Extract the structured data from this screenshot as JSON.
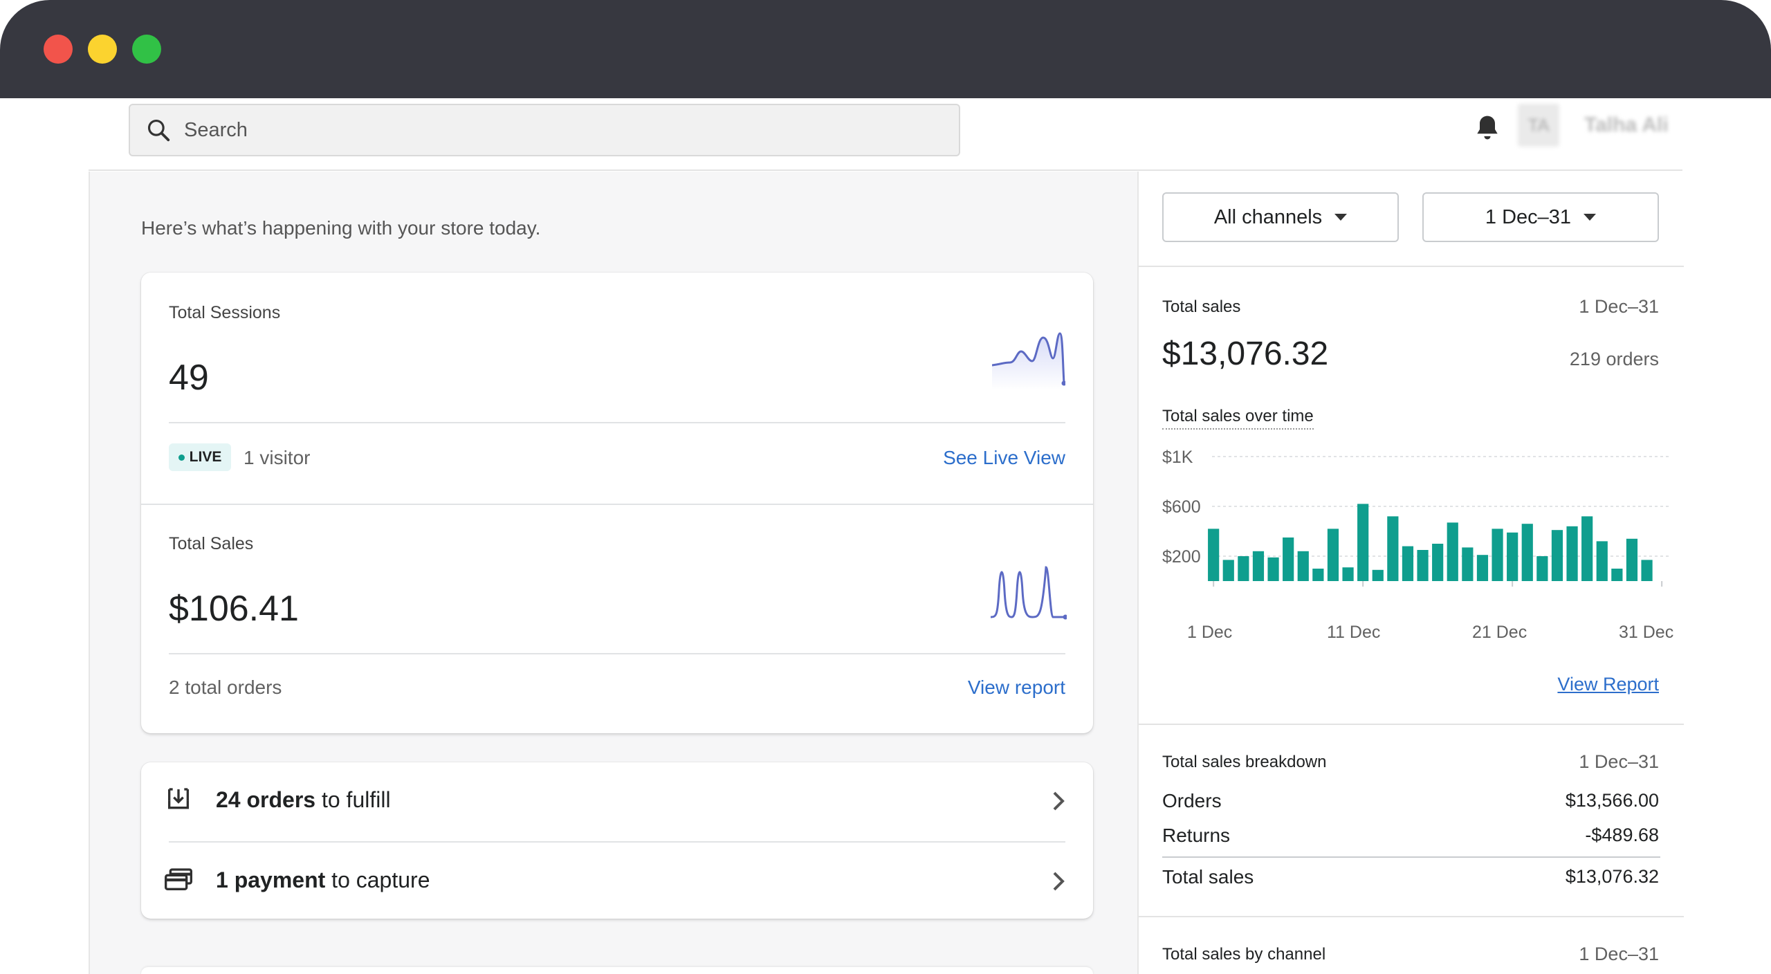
{
  "window": {
    "controls": [
      "close",
      "minimize",
      "maximize"
    ]
  },
  "topbar": {
    "search_placeholder": "Search",
    "search_icon": "search-icon",
    "notification_icon": "bell-icon",
    "avatar_initials": "TA",
    "user_name": "Talha Ali"
  },
  "home": {
    "subtitle": "Here’s what’s happening with your store today.",
    "sessions": {
      "label": "Total Sessions",
      "value": "49",
      "live_badge": "LIVE",
      "visitors": "1 visitor",
      "link": "See Live View"
    },
    "sales": {
      "label": "Total Sales",
      "value": "$106.41",
      "orders": "2 total orders",
      "link": "View report"
    },
    "tasks": [
      {
        "icon": "inbox-download-icon",
        "bold": "24 orders",
        "rest": " to fulfill"
      },
      {
        "icon": "payment-card-icon",
        "bold": "1 payment",
        "rest": " to capture"
      }
    ]
  },
  "sidebar": {
    "channel_filter": "All channels",
    "date_filter": "1 Dec–31",
    "total_sales": {
      "label": "Total sales",
      "date": "1 Dec–31",
      "value": "$13,076.32",
      "orders": "219 orders",
      "chart_title": "Total sales over time",
      "link": "View Report"
    },
    "breakdown": {
      "label": "Total sales breakdown",
      "date": "1 Dec–31",
      "rows": [
        {
          "name": "Orders",
          "value": "$13,566.00"
        },
        {
          "name": "Returns",
          "value": "-$489.68"
        }
      ],
      "total": {
        "name": "Total sales",
        "value": "$13,076.32"
      }
    },
    "by_channel": {
      "label": "Total sales by channel",
      "date": "1 Dec–31"
    }
  },
  "colors": {
    "bar": "#0f9e8e",
    "link": "#2c6ecb",
    "sparkline": "#5c6ac4"
  },
  "chart_data": {
    "type": "bar",
    "title": "Total sales over time",
    "x": [
      1,
      2,
      3,
      4,
      5,
      6,
      7,
      8,
      9,
      10,
      11,
      12,
      13,
      14,
      15,
      16,
      17,
      18,
      19,
      20,
      21,
      22,
      23,
      24,
      25,
      26,
      27,
      28,
      29,
      30,
      31
    ],
    "values": [
      420,
      170,
      200,
      240,
      190,
      350,
      240,
      100,
      420,
      110,
      620,
      90,
      520,
      280,
      250,
      300,
      470,
      270,
      210,
      420,
      390,
      460,
      200,
      410,
      440,
      520,
      320,
      100,
      340,
      170
    ],
    "xticks": [
      "1 Dec",
      "11 Dec",
      "21 Dec",
      "31 Dec"
    ],
    "ytick_labels": [
      "$1K",
      "$600",
      "$200"
    ],
    "yticks": [
      1000,
      600,
      200
    ],
    "ylim": [
      0,
      1000
    ],
    "grid": true
  }
}
